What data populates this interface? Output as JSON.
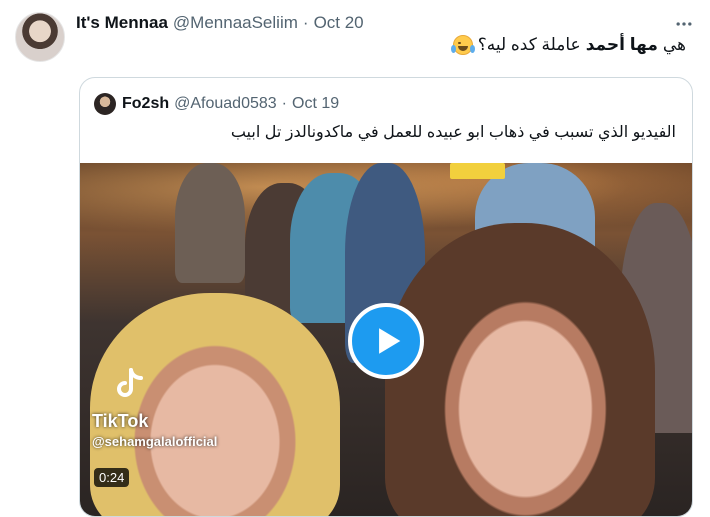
{
  "tweet": {
    "display_name": "It's Mennaa",
    "handle": "@MennaaSeliim",
    "separator": "·",
    "date": "Oct 20",
    "text_prefix": "هي",
    "text_bold": "مها أحمد",
    "text_suffix": "عاملة كده ليه؟",
    "emoji": "face-with-tears-of-joy"
  },
  "quoted": {
    "display_name": "Fo2sh",
    "handle": "@Afouad0583",
    "separator": "·",
    "date": "Oct 19",
    "text": "الفيديو الذي تسبب في ذهاب ابو عبيده للعمل في ماكدونالدز تل ابيب",
    "video": {
      "watermark_label": "TikTok",
      "watermark_user": "@sehamgalalofficial",
      "duration": "0:24"
    }
  },
  "colors": {
    "accent": "#1d9bf0",
    "text_primary": "#0f1419",
    "text_secondary": "#536471",
    "border": "#cfd9de"
  }
}
